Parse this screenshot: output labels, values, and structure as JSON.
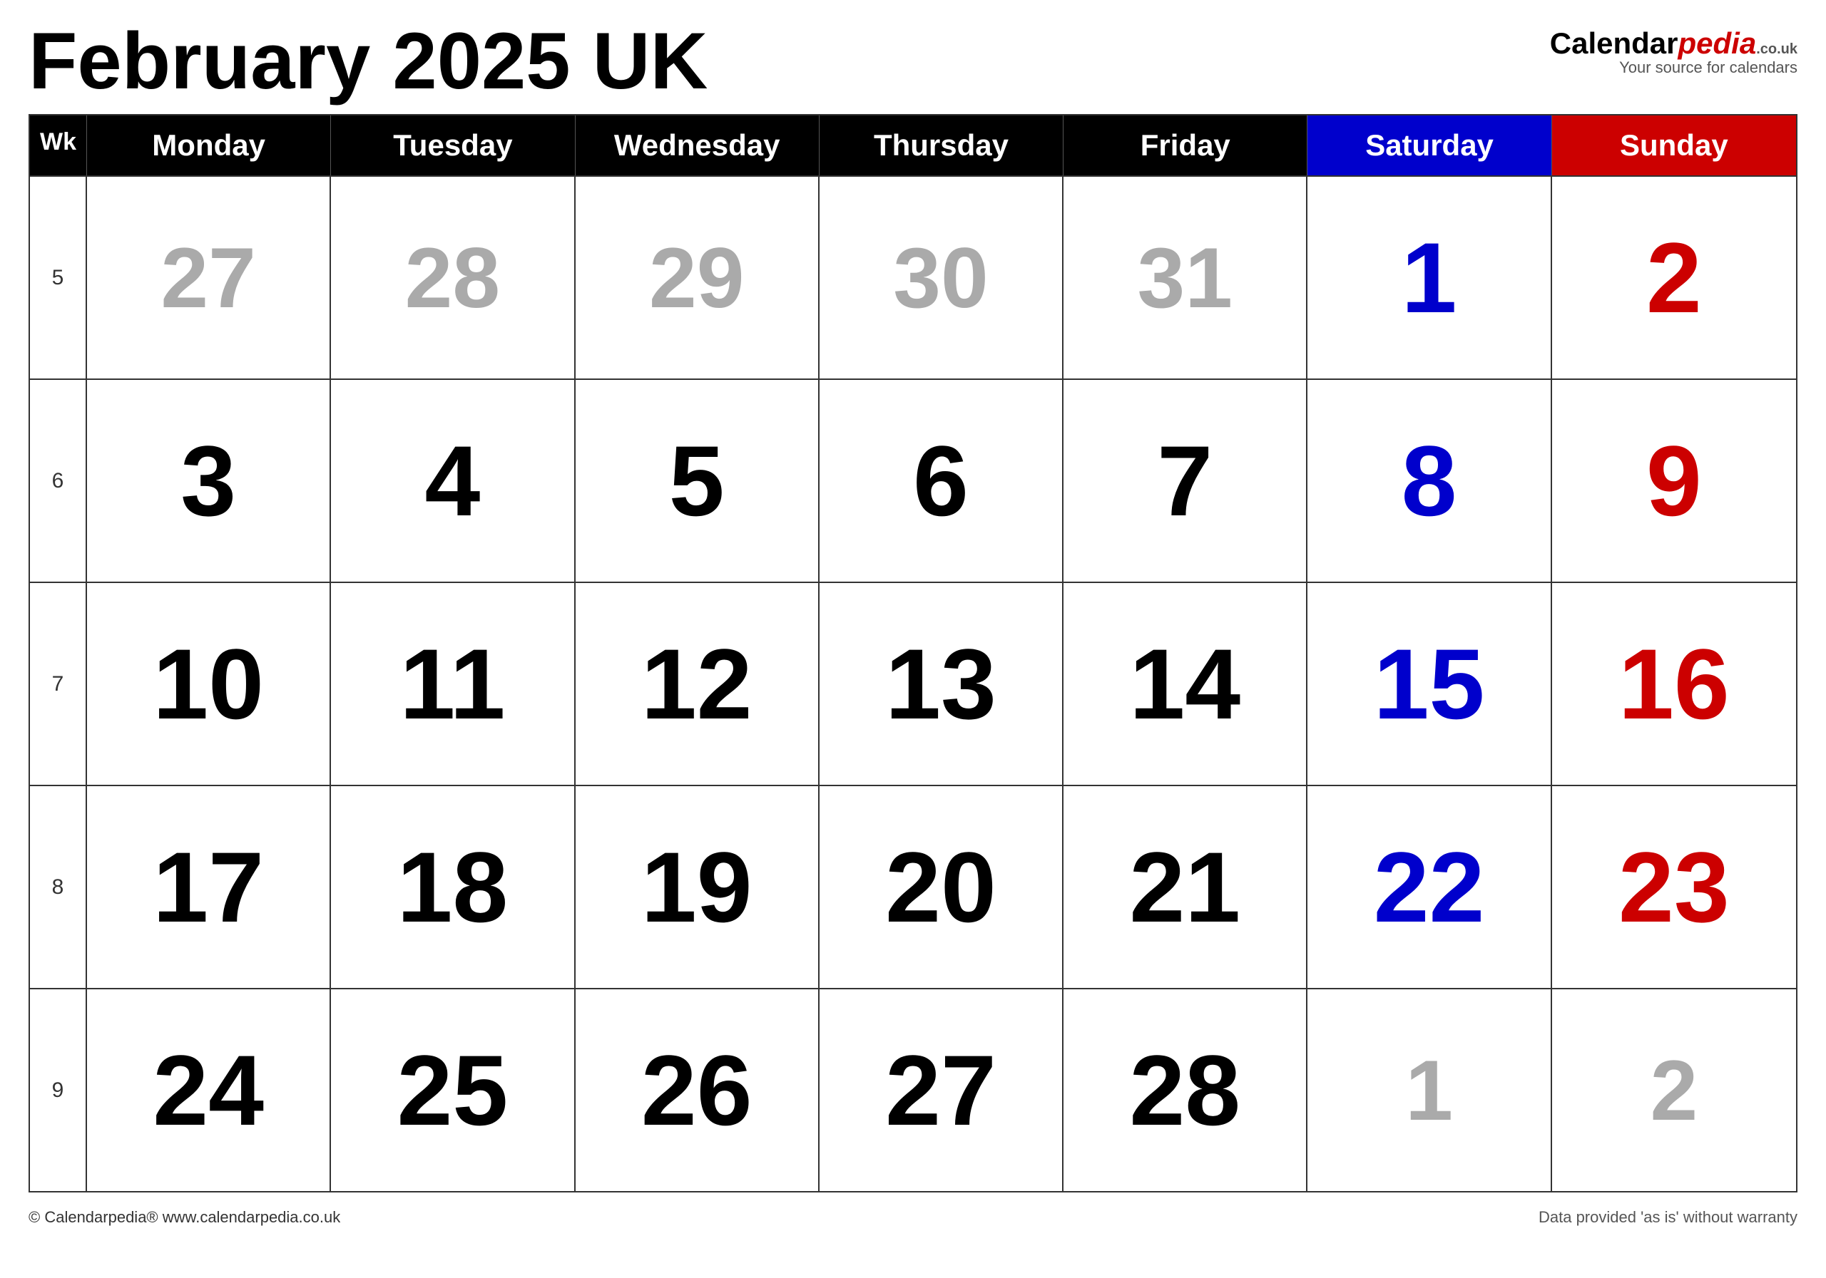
{
  "page": {
    "title": "February 2025 UK"
  },
  "logo": {
    "calendar_text": "Calendar",
    "pedia_text": "pedia",
    "co_uk": ".co.uk",
    "tagline": "Your source for calendars"
  },
  "header": {
    "wk_label": "Wk",
    "days": [
      "Monday",
      "Tuesday",
      "Wednesday",
      "Thursday",
      "Friday",
      "Saturday",
      "Sunday"
    ]
  },
  "weeks": [
    {
      "wk": "5",
      "days": [
        {
          "num": "27",
          "type": "prev-month"
        },
        {
          "num": "28",
          "type": "prev-month"
        },
        {
          "num": "29",
          "type": "prev-month"
        },
        {
          "num": "30",
          "type": "prev-month"
        },
        {
          "num": "31",
          "type": "prev-month"
        },
        {
          "num": "1",
          "type": "saturday"
        },
        {
          "num": "2",
          "type": "sunday"
        }
      ]
    },
    {
      "wk": "6",
      "days": [
        {
          "num": "3",
          "type": "weekday"
        },
        {
          "num": "4",
          "type": "weekday"
        },
        {
          "num": "5",
          "type": "weekday"
        },
        {
          "num": "6",
          "type": "weekday"
        },
        {
          "num": "7",
          "type": "weekday"
        },
        {
          "num": "8",
          "type": "saturday"
        },
        {
          "num": "9",
          "type": "sunday"
        }
      ]
    },
    {
      "wk": "7",
      "days": [
        {
          "num": "10",
          "type": "weekday"
        },
        {
          "num": "11",
          "type": "weekday"
        },
        {
          "num": "12",
          "type": "weekday"
        },
        {
          "num": "13",
          "type": "weekday"
        },
        {
          "num": "14",
          "type": "weekday"
        },
        {
          "num": "15",
          "type": "saturday"
        },
        {
          "num": "16",
          "type": "sunday"
        }
      ]
    },
    {
      "wk": "8",
      "days": [
        {
          "num": "17",
          "type": "weekday"
        },
        {
          "num": "18",
          "type": "weekday"
        },
        {
          "num": "19",
          "type": "weekday"
        },
        {
          "num": "20",
          "type": "weekday"
        },
        {
          "num": "21",
          "type": "weekday"
        },
        {
          "num": "22",
          "type": "saturday"
        },
        {
          "num": "23",
          "type": "sunday"
        }
      ]
    },
    {
      "wk": "9",
      "days": [
        {
          "num": "24",
          "type": "weekday"
        },
        {
          "num": "25",
          "type": "weekday"
        },
        {
          "num": "26",
          "type": "weekday"
        },
        {
          "num": "27",
          "type": "weekday"
        },
        {
          "num": "28",
          "type": "weekday"
        },
        {
          "num": "1",
          "type": "next-month"
        },
        {
          "num": "2",
          "type": "next-month"
        }
      ]
    }
  ],
  "footer": {
    "left": "© Calendarpedia®  www.calendarpedia.co.uk",
    "right": "Data provided 'as is' without warranty"
  }
}
